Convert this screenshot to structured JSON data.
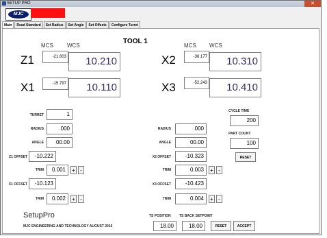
{
  "window": {
    "title": "SETUP PRO",
    "close_glyph": "✕",
    "brand": "MJC"
  },
  "tabs": [
    {
      "label": "Main"
    },
    {
      "label": "Read Standard"
    },
    {
      "label": "Set Radius"
    },
    {
      "label": "Set Angle"
    },
    {
      "label": "Set Offsets"
    },
    {
      "label": "Configure Turret"
    }
  ],
  "tool_title": "TOOL 1",
  "columns": {
    "mcs": "MCS",
    "wcs": "WCS"
  },
  "axes": {
    "z1": {
      "label": "Z1",
      "mcs": "-21.603",
      "wcs": "10.210"
    },
    "x1": {
      "label": "X1",
      "mcs": "-15.797",
      "wcs": "10.110"
    },
    "x2": {
      "label": "X2",
      "mcs": "-36.177",
      "wcs": "10.310"
    },
    "x3": {
      "label": "X3",
      "mcs": "-52.243",
      "wcs": "10.410"
    }
  },
  "left_fields": {
    "turret": {
      "label": "TURRET",
      "value": "1"
    },
    "radius": {
      "label": "RADIUS",
      "value": ".000"
    },
    "angle": {
      "label": "ANGLE",
      "value": "00.00"
    },
    "z1_offset": {
      "label": "Z1 OFFSET",
      "value": "-10.222"
    },
    "trim1": {
      "label": "TRIM",
      "value": "0.001"
    },
    "x1_offset": {
      "label": "X1 OFFSET",
      "value": "-10.123"
    },
    "trim2": {
      "label": "TRIM",
      "value": "0.002"
    }
  },
  "right_fields": {
    "radius": {
      "label": "RADIUS",
      "value": ".000"
    },
    "angle": {
      "label": "ANGLE",
      "value": "00.00"
    },
    "x2_offset": {
      "label": "X2 OFFSET",
      "value": "-10.323"
    },
    "trim1": {
      "label": "TRIM",
      "value": "0.003"
    },
    "x3_offset": {
      "label": "X3 OFFSET",
      "value": "-10.423"
    },
    "trim2": {
      "label": "TRIM",
      "value": "0.004"
    }
  },
  "stepper": {
    "plus": "+",
    "minus": "-"
  },
  "cycle": {
    "label": "CYCLE TIME",
    "value": "200"
  },
  "part_count": {
    "label": "PART COUNT",
    "value": "100",
    "reset": "RESET"
  },
  "ts": {
    "position_label": "TS POSITION",
    "position_value": "18.00",
    "setpoint_label": "TS BACK SETPOINT",
    "setpoint_value": "18.00",
    "reset": "RESET",
    "accept": "ACCEPT"
  },
  "footer": {
    "title": "SetupPro",
    "subtitle": "MJC ENGINEERING AND TECHNOLOGY AUGUST 2016"
  }
}
